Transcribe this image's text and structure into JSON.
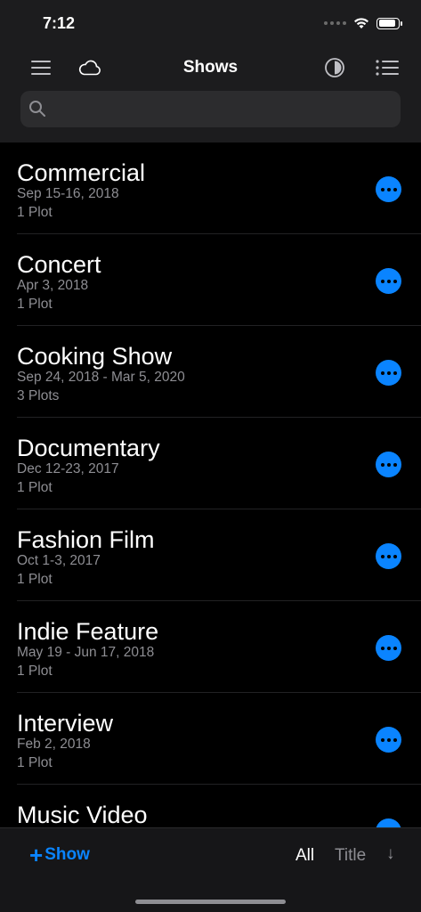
{
  "status_bar": {
    "time": "7:12",
    "battery_level": 0.9
  },
  "nav": {
    "title": "Shows",
    "menu_icon": "hamburger-menu-icon",
    "cloud_icon": "cloud-icon",
    "appearance_icon": "half-circle-contrast-icon",
    "list_icon": "list-bullets-icon"
  },
  "search": {
    "value": "",
    "placeholder": "",
    "icon": "search-icon"
  },
  "shows": [
    {
      "title": "Commercial",
      "dates": "Sep 15-16, 2018",
      "plots": "1 Plot"
    },
    {
      "title": "Concert",
      "dates": "Apr 3, 2018",
      "plots": "1 Plot"
    },
    {
      "title": "Cooking Show",
      "dates": "Sep 24, 2018 - Mar 5, 2020",
      "plots": "3 Plots"
    },
    {
      "title": "Documentary",
      "dates": "Dec 12-23, 2017",
      "plots": "1 Plot"
    },
    {
      "title": "Fashion Film",
      "dates": "Oct 1-3, 2017",
      "plots": "1 Plot"
    },
    {
      "title": "Indie Feature",
      "dates": "May 19 - Jun 17, 2018",
      "plots": "1 Plot"
    },
    {
      "title": "Interview",
      "dates": "Feb 2, 2018",
      "plots": "1 Plot"
    },
    {
      "title": "Music Video",
      "dates": "",
      "plots": ""
    }
  ],
  "toolbar": {
    "add_plus": "+",
    "add_label": "Show",
    "filter_label": "All",
    "sort_label": "Title",
    "sort_direction": "↓"
  },
  "colors": {
    "accent": "#0a84ff",
    "background": "#000000",
    "bar": "#1c1c1e",
    "secondary_text": "#8e8e93"
  }
}
